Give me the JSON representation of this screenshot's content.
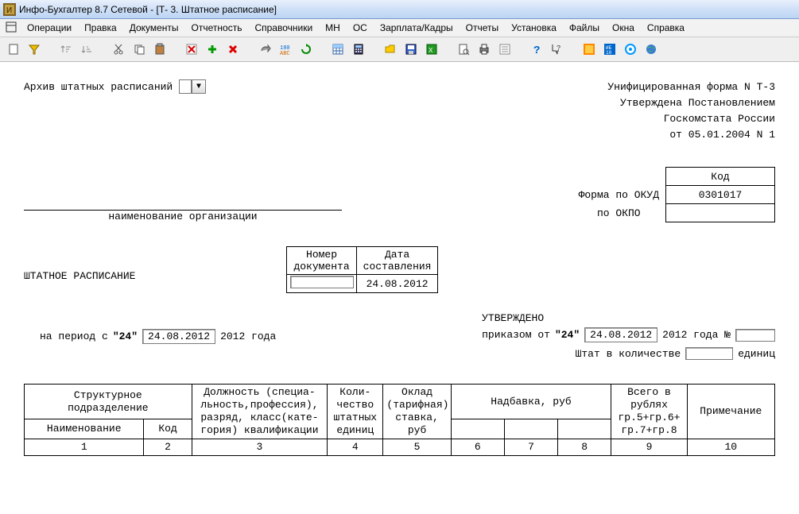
{
  "title": "Инфо-Бухгалтер 8.7 Сетевой - [Т- 3. Штатное расписание]",
  "menu": {
    "items": [
      "Операции",
      "Правка",
      "Документы",
      "Отчетность",
      "Справочники",
      "МН",
      "ОС",
      "Зарплата/Кадры",
      "Отчеты",
      "Установка",
      "Файлы",
      "Окна",
      "Справка"
    ]
  },
  "archive": {
    "label": "Архив штатных расписаний",
    "value": ""
  },
  "form_header": {
    "line1": "Унифицированная форма N Т-3",
    "line2": "Утверждена Постановлением",
    "line3": "Госкомстата России",
    "line4": "от 05.01.2004 N 1"
  },
  "org": {
    "caption": "наименование организации"
  },
  "codes": {
    "kod_hdr": "Код",
    "okud_label": "Форма по ОКУД",
    "okud_value": "0301017",
    "okpo_label": "по ОКПО",
    "okpo_value": ""
  },
  "doc_title": "ШТАТНОЕ РАСПИСАНИЕ",
  "doc_num": {
    "num_hdr": "Номер\nдокумента",
    "date_hdr": "Дата\nсоставления",
    "num_value": "",
    "date_value": "24.08.2012"
  },
  "period": {
    "prefix": "на  период с",
    "day": "\"24\"",
    "date": "24.08.2012",
    "suffix": "2012 года"
  },
  "approved": {
    "title": "УТВЕРЖДЕНО",
    "prefix": "приказом от",
    "day": "\"24\"",
    "date": "24.08.2012",
    "suffix": "2012 года  №",
    "num": "",
    "staff_prefix": "Штат в количестве",
    "staff_value": "",
    "staff_suffix": "единиц"
  },
  "table": {
    "struct_hdr": "Структурное\nподразделение",
    "name_hdr": "Наименование",
    "code_hdr": "Код",
    "pos_hdr": "Должность (специа-\nльность,профессия),\nразряд, класс(кате-\nгория) квалификации",
    "qty_hdr": "Коли-\nчество\nштатных\nединиц",
    "salary_hdr": "Оклад\n(тарифная)\nставка,\nруб",
    "allowance_hdr": "Надбавка, руб",
    "total_hdr": "Всего в\nрублях\nгр.5+гр.6+\nгр.7+гр.8",
    "note_hdr": "Примечание",
    "nums": [
      "1",
      "2",
      "3",
      "4",
      "5",
      "6",
      "7",
      "8",
      "9",
      "10"
    ]
  }
}
